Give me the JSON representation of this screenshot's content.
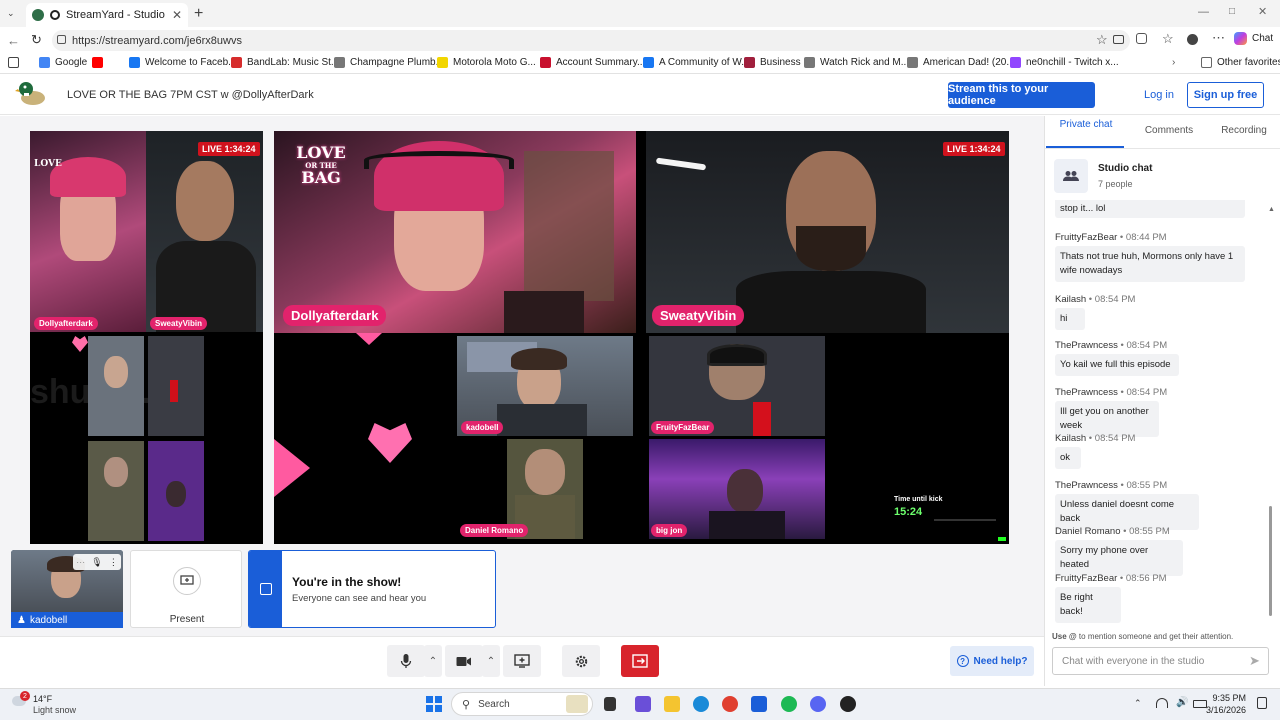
{
  "browser": {
    "tab_title": "StreamYard - Studio",
    "url": "https://streamyard.com/je6rx8uwvs",
    "chat_button_label": "Chat",
    "bookmarks": [
      {
        "label": "Google",
        "color": "#4285f4"
      },
      {
        "label": "",
        "color": "#ff0000"
      },
      {
        "label": "Welcome to Faceb...",
        "color": "#1877f2"
      },
      {
        "label": "BandLab: Music St...",
        "color": "#d62c2c"
      },
      {
        "label": "Champagne Plumb...",
        "color": "#777777"
      },
      {
        "label": "Motorola Moto G...",
        "color": "#f2d600"
      },
      {
        "label": "Account Summary...",
        "color": "#c8102e"
      },
      {
        "label": "A Community of W...",
        "color": "#1877f2"
      },
      {
        "label": "Business",
        "color": "#a01f3c"
      },
      {
        "label": "Watch Rick and M...",
        "color": "#777777"
      },
      {
        "label": "American Dad! (20...",
        "color": "#777777"
      },
      {
        "label": "ne0nchill - Twitch x...",
        "color": "#9146ff"
      }
    ],
    "other_favorites": "Other favorites"
  },
  "header": {
    "show_title": "LOVE OR THE BAG 7PM CST w @DollyAfterDark",
    "stream_button": "Stream this to your audience",
    "login": "Log in",
    "signup": "Sign up free"
  },
  "stage": {
    "live_timer": "LIVE 1:34:24",
    "logo_text_1": "LOVE",
    "logo_text_2": "OR THE",
    "logo_text_3": "BAG",
    "hosts": [
      {
        "name": "Dollyafterdark",
        "bg": "#6a2a4a"
      },
      {
        "name": "SweatyVibin",
        "bg": "#2a2f35"
      }
    ],
    "guests": [
      {
        "name": "kadobell",
        "bg": "#5a6470"
      },
      {
        "name": "FruityFazBear",
        "bg": "#3a3c44"
      },
      {
        "name": "Daniel Romano",
        "bg": "#4a4a3a"
      },
      {
        "name": "big jon",
        "bg": "#5a2a8a"
      }
    ],
    "kick_label": "Time until kick",
    "kick_time": "15:24",
    "watermark": "shuffle.ch"
  },
  "bottom": {
    "self_name": "kadobell",
    "present_label": "Present",
    "inshow_title": "You're in the show!",
    "inshow_sub": "Everyone can see and hear you"
  },
  "controls": {
    "help": "Need help?"
  },
  "chat": {
    "tabs": [
      "Private chat",
      "Comments",
      "Recording"
    ],
    "room_title": "Studio chat",
    "room_count": "7 people",
    "first_partial": "stop it... lol",
    "messages": [
      {
        "name": "FruittyFazBear",
        "time": "08:44 PM",
        "text": "Thats not true huh, Mormons only have 1 wife nowadays"
      },
      {
        "name": "Kailash",
        "time": "08:54 PM",
        "text": "hi"
      },
      {
        "name": "ThePrawncess",
        "time": "08:54 PM",
        "text": "Yo kail we full this episode"
      },
      {
        "name": "ThePrawncess",
        "time": "08:54 PM",
        "text": "Ill get you on another week"
      },
      {
        "name": "Kailash",
        "time": "08:54 PM",
        "text": "ok"
      },
      {
        "name": "ThePrawncess",
        "time": "08:55 PM",
        "text": "Unless daniel doesnt come back"
      },
      {
        "name": "Daniel Romano",
        "time": "08:55 PM",
        "text": "Sorry my phone over heated"
      },
      {
        "name": "FruittyFazBear",
        "time": "08:56 PM",
        "text": "Be right back!"
      }
    ],
    "hint_bold": "Use @",
    "hint_rest": " to mention someone and get their attention.",
    "input_placeholder": "Chat with everyone in the studio"
  },
  "taskbar": {
    "weather_temp": "14°F",
    "weather_desc": "Light snow",
    "weather_badge": "2",
    "search": "Search",
    "time": "9:35 PM",
    "date": "3/16/2026"
  }
}
